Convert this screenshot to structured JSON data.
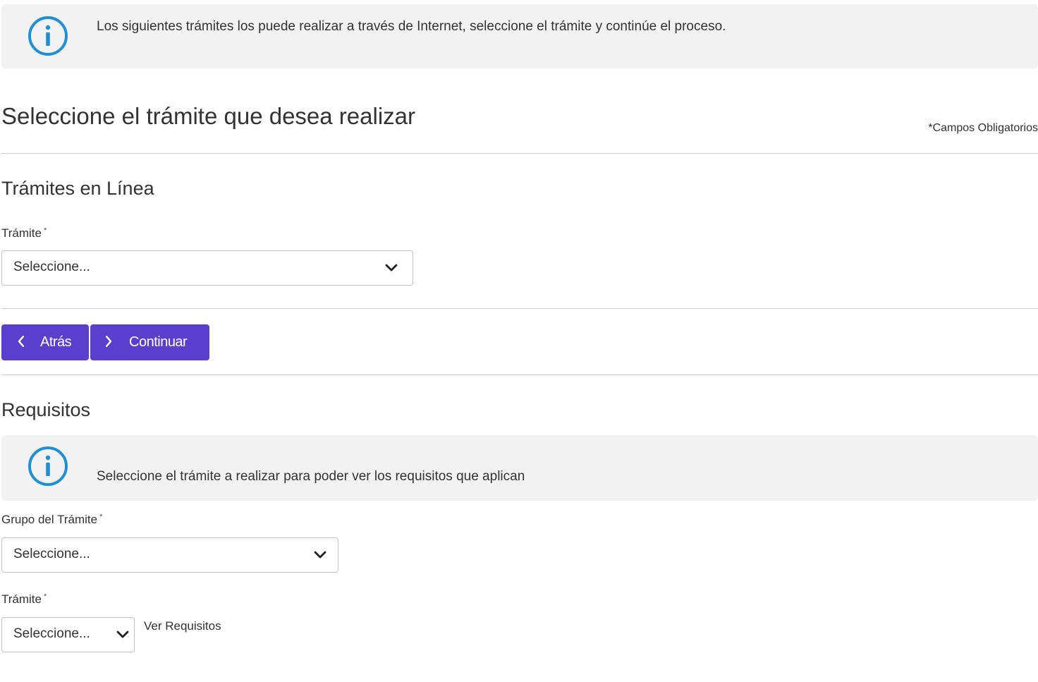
{
  "info_top": {
    "icon": "info-icon",
    "text": "Los siguientes trámites los puede realizar a través de Internet, seleccione el trámite y continúe el proceso."
  },
  "page_title": "Seleccione el trámite que desea realizar",
  "required_note": "*Campos Obligatorios",
  "online_section": {
    "title": "Trámites en Línea",
    "tramite_label": "Trámite",
    "required_marker": "*",
    "tramite_select_value": "Seleccione..."
  },
  "buttons": {
    "back_label": "Atrás",
    "back_icon": "chevron-left-icon",
    "continue_label": "Continuar",
    "continue_icon": "chevron-right-icon"
  },
  "requirements": {
    "title": "Requisitos",
    "info_text": "Seleccione el trámite a realizar para poder ver los requisitos que aplican",
    "group_label": "Grupo del Trámite",
    "group_select_value": "Seleccione...",
    "tramite_label": "Trámite",
    "tramite_select_value": "Seleccione...",
    "required_marker": "*",
    "view_link": "Ver Requisitos"
  },
  "colors": {
    "accent": "#5a3fcf",
    "info_icon": "#1f8fd6",
    "info_bg": "#f2f2f2"
  }
}
